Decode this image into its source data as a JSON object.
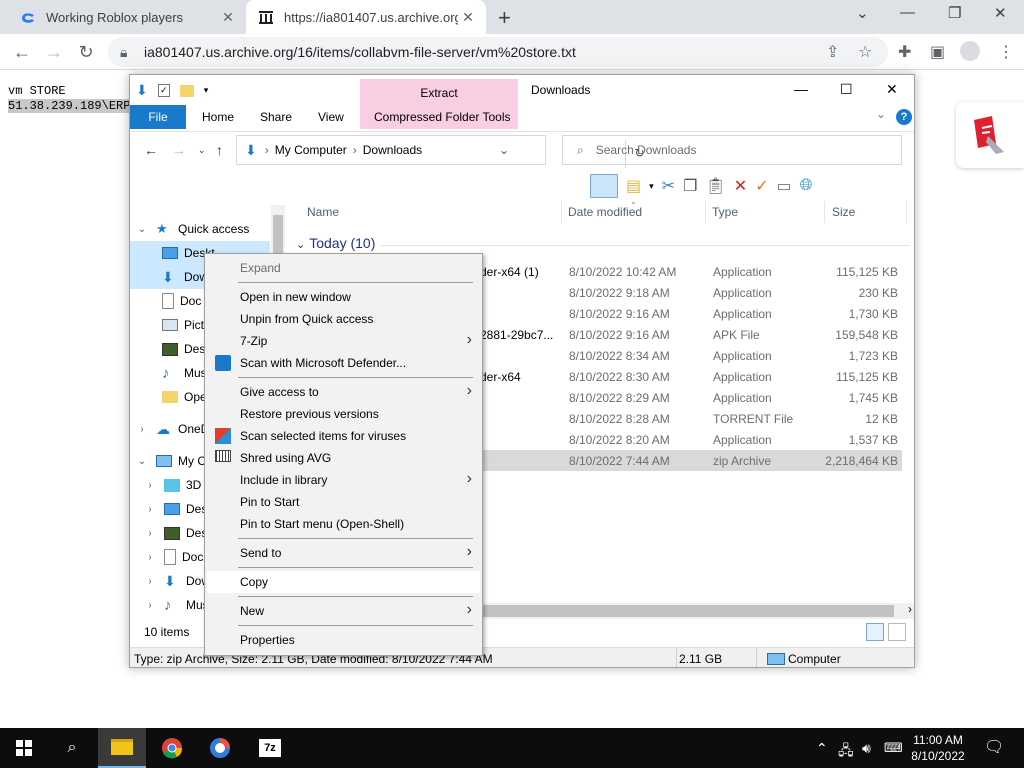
{
  "browser": {
    "tabs": [
      {
        "title": "Working Roblox players",
        "active": false
      },
      {
        "title": "https://ia801407.us.archive.org/1",
        "active": true
      }
    ],
    "url": "ia801407.us.archive.org/16/items/collabvm-file-server/vm%20store.txt",
    "page_lines": [
      "vm STORE",
      "51.38.239.189\\ERP"
    ]
  },
  "explorer": {
    "title": "Downloads",
    "contextual_tab": "Extract",
    "ribbon_tabs": [
      "File",
      "Home",
      "Share",
      "View",
      "Compressed Folder Tools"
    ],
    "breadcrumb": [
      "My Computer",
      "Downloads"
    ],
    "search_placeholder": "Search Downloads",
    "nav": {
      "quick_access": "Quick access",
      "items": [
        "Deskt",
        "Dow",
        "Doc",
        "Pict",
        "Desk",
        "Mus",
        "Ope"
      ],
      "onedrive": "OneD",
      "my_computer": "My C",
      "computer_items": [
        "3D C",
        "Desk",
        "Desk",
        "Doc",
        "Dow",
        "Mus"
      ]
    },
    "columns": [
      "Name",
      "Date modified",
      "Type",
      "Size"
    ],
    "group": "Today (10)",
    "rows": [
      {
        "name": "der-x64 (1)",
        "date": "8/10/2022 10:42 AM",
        "type": "Application",
        "size": "115,125 KB",
        "selected": false
      },
      {
        "name": "",
        "date": "8/10/2022 9:18 AM",
        "type": "Application",
        "size": "230 KB",
        "selected": false
      },
      {
        "name": "",
        "date": "8/10/2022 9:16 AM",
        "type": "Application",
        "size": "1,730 KB",
        "selected": false
      },
      {
        "name": "2881-29bc7...",
        "date": "8/10/2022 9:16 AM",
        "type": "APK File",
        "size": "159,548 KB",
        "selected": false
      },
      {
        "name": "",
        "date": "8/10/2022 8:34 AM",
        "type": "Application",
        "size": "1,723 KB",
        "selected": false
      },
      {
        "name": "der-x64",
        "date": "8/10/2022 8:30 AM",
        "type": "Application",
        "size": "115,125 KB",
        "selected": false
      },
      {
        "name": "",
        "date": "8/10/2022 8:29 AM",
        "type": "Application",
        "size": "1,745 KB",
        "selected": false
      },
      {
        "name": "",
        "date": "8/10/2022 8:28 AM",
        "type": "TORRENT File",
        "size": "12 KB",
        "selected": false
      },
      {
        "name": "",
        "date": "8/10/2022 8:20 AM",
        "type": "Application",
        "size": "1,537 KB",
        "selected": false
      },
      {
        "name": "",
        "date": "8/10/2022 7:44 AM",
        "type": "zip Archive",
        "size": "2,218,464 KB",
        "selected": true
      }
    ],
    "items_count": "10 items",
    "status": {
      "details": "Type: zip Archive, Size: 2.11 GB, Date modified: 8/10/2022 7:44 AM",
      "size": "2.11 GB",
      "location": "Computer"
    }
  },
  "context_menu": {
    "expand": "Expand",
    "open_new_window": "Open in new window",
    "unpin": "Unpin from Quick access",
    "zip7": "7-Zip",
    "defender": "Scan with Microsoft Defender...",
    "give_access": "Give access to",
    "restore": "Restore previous versions",
    "scan_viruses": "Scan selected items for viruses",
    "shred": "Shred using AVG",
    "include_library": "Include in library",
    "pin_start": "Pin to Start",
    "pin_start_openshell": "Pin to Start menu (Open-Shell)",
    "send_to": "Send to",
    "copy": "Copy",
    "new": "New",
    "properties": "Properties"
  },
  "taskbar": {
    "time": "11:00 AM",
    "date": "8/10/2022"
  },
  "colors": {
    "accent": "#1979ca",
    "extract_band": "#f9cde2",
    "selection": "#cce8ff",
    "taskbar": "#0d0d0d"
  }
}
